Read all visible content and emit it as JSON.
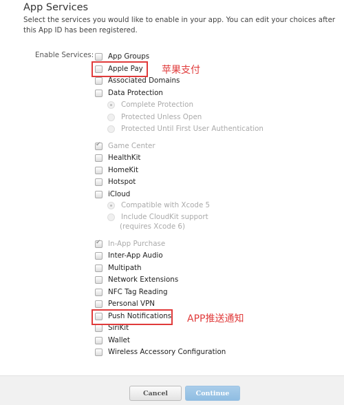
{
  "header": {
    "title": "App Services",
    "description": "Select the services you would like to enable in your app. You can edit your choices after this App ID has been registered."
  },
  "enable_label": "Enable Services:",
  "services": [
    {
      "label": "App Groups",
      "checked": false
    },
    {
      "label": "Apple Pay",
      "checked": false
    },
    {
      "label": "Associated Domains",
      "checked": false
    },
    {
      "label": "Data Protection",
      "checked": false
    },
    {
      "label": "Complete Protection",
      "selected": true
    },
    {
      "label": "Protected Unless Open",
      "selected": false
    },
    {
      "label": "Protected Until First User Authentication",
      "selected": false
    },
    {
      "label": "Game Center",
      "checked": true,
      "disabled": true
    },
    {
      "label": "HealthKit",
      "checked": false
    },
    {
      "label": "HomeKit",
      "checked": false
    },
    {
      "label": "Hotspot",
      "checked": false
    },
    {
      "label": "iCloud",
      "checked": false
    },
    {
      "label": "Compatible with Xcode 5",
      "selected": true
    },
    {
      "label": "Include CloudKit support",
      "selected": false
    },
    {
      "label": "(requires Xcode 6)"
    },
    {
      "label": "In-App Purchase",
      "checked": true,
      "disabled": true
    },
    {
      "label": "Inter-App Audio",
      "checked": false
    },
    {
      "label": "Multipath",
      "checked": false
    },
    {
      "label": "Network Extensions",
      "checked": false
    },
    {
      "label": "NFC Tag Reading",
      "checked": false
    },
    {
      "label": "Personal VPN",
      "checked": false
    },
    {
      "label": "Push Notifications",
      "checked": false
    },
    {
      "label": "SiriKit",
      "checked": false
    },
    {
      "label": "Wallet",
      "checked": false
    },
    {
      "label": "Wireless Accessory Configuration",
      "checked": false
    }
  ],
  "annotations": {
    "apple_pay": "苹果支付",
    "push": "APP推送通知",
    "color": "#e03a3a"
  },
  "footer": {
    "cancel": "Cancel",
    "continue": "Continue"
  }
}
